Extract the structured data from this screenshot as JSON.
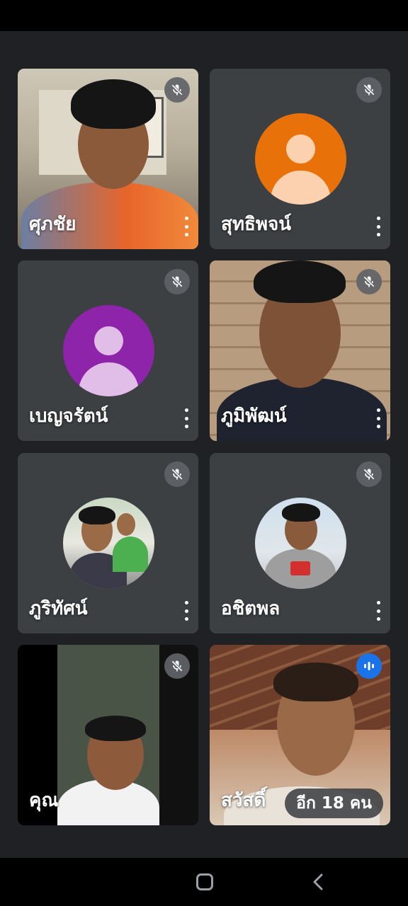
{
  "participants": [
    {
      "name": "ศุภชัย",
      "type": "video",
      "muted": true
    },
    {
      "name": "สุทธิพจน์",
      "type": "avatar",
      "avatar_color": "#e8710a",
      "muted": true
    },
    {
      "name": "เบญจรัตน์",
      "type": "avatar",
      "avatar_color": "#8e24aa",
      "muted": true
    },
    {
      "name": "ภูมิพัฒน์",
      "type": "video",
      "muted": true
    },
    {
      "name": "ภูริทัศน์",
      "type": "photo-avatar",
      "muted": true
    },
    {
      "name": "อชิตพล",
      "type": "photo-avatar",
      "muted": true
    },
    {
      "name": "คุณ",
      "type": "video",
      "muted": true
    },
    {
      "name": "สวัสดิ์",
      "type": "video",
      "speaking": true
    }
  ],
  "others_count_label": "อีก 18 คน",
  "colors": {
    "background": "#202124",
    "tile": "#3c4043",
    "mic_badge": "#5f6368",
    "speaking_badge": "#1a73e8"
  },
  "icons": {
    "muted": "mic-off-icon",
    "speaking": "audio-wave-icon",
    "menu": "more-vert-icon",
    "home": "home-icon",
    "back": "back-icon"
  }
}
